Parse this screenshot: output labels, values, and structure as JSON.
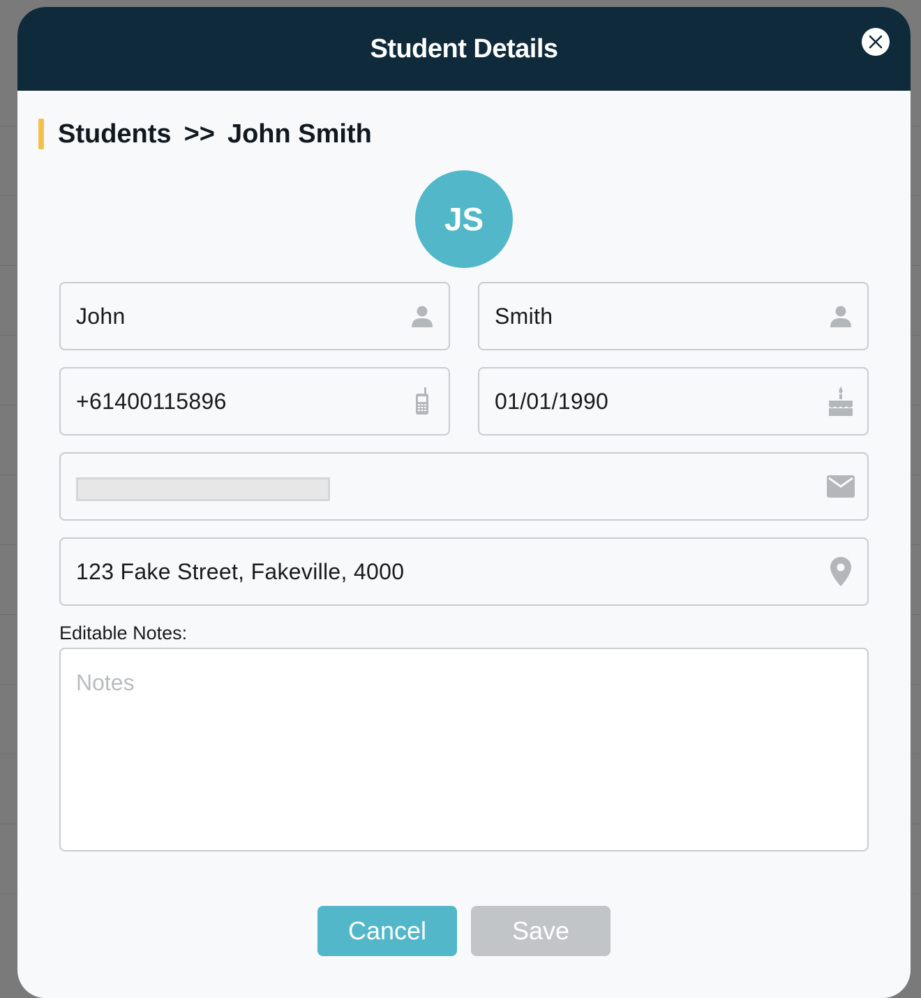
{
  "modal": {
    "title": "Student Details"
  },
  "breadcrumb": {
    "parent": "Students",
    "separator": ">>",
    "current": "John Smith"
  },
  "avatar": {
    "initials": "JS",
    "color": "#52b8c9"
  },
  "form": {
    "first_name": {
      "value": "John",
      "icon": "person-icon"
    },
    "last_name": {
      "value": "Smith",
      "icon": "person-icon"
    },
    "phone": {
      "value": "+61400115896",
      "icon": "mobile-phone-icon"
    },
    "birth_date": {
      "value": "01/01/1990",
      "icon": "birthday-cake-icon"
    },
    "email": {
      "value": "",
      "icon": "envelope-icon",
      "redacted": true
    },
    "address": {
      "value": "123 Fake Street, Fakeville, 4000",
      "icon": "location-pin-icon"
    },
    "notes": {
      "label": "Editable Notes:",
      "placeholder": "Notes",
      "value": ""
    }
  },
  "buttons": {
    "cancel": "Cancel",
    "save": "Save"
  },
  "colors": {
    "header_bg": "#0f2a3a",
    "accent": "#52b8c9",
    "breadcrumb_marker": "#f3c14b",
    "save_disabled": "#c2c5c8"
  }
}
